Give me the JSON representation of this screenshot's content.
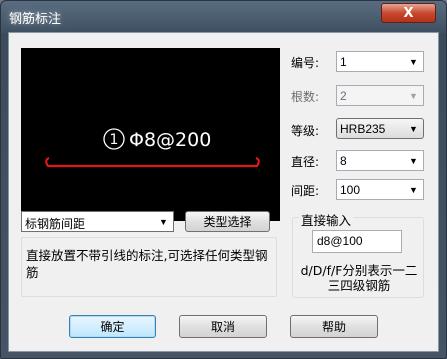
{
  "window": {
    "title": "钢筋标注",
    "close_glyph": "X"
  },
  "preview": {
    "circle_number": "1",
    "annotation": "Φ8@200",
    "line_color": "#e01818"
  },
  "fields": {
    "number": {
      "label": "编号:",
      "value": "1"
    },
    "count": {
      "label": "根数:",
      "value": "2"
    },
    "grade": {
      "label": "等级:",
      "value": "HRB235"
    },
    "diameter": {
      "label": "直径:",
      "value": "8"
    },
    "spacing": {
      "label": "间距:",
      "value": "100"
    }
  },
  "annotation_type": {
    "value": "标钢筋间距"
  },
  "type_select_label": "类型选择",
  "description": "直接放置不带引线的标注,可选择任何类型钢筋",
  "direct_input": {
    "label": "直接输入",
    "value": "d8@100",
    "hint": "d/D/f/F分别表示一二三四级钢筋"
  },
  "buttons": {
    "ok": "确定",
    "cancel": "取消",
    "help": "帮助"
  },
  "icons": {
    "dropdown": "chevron-down-icon",
    "close": "close-icon"
  }
}
